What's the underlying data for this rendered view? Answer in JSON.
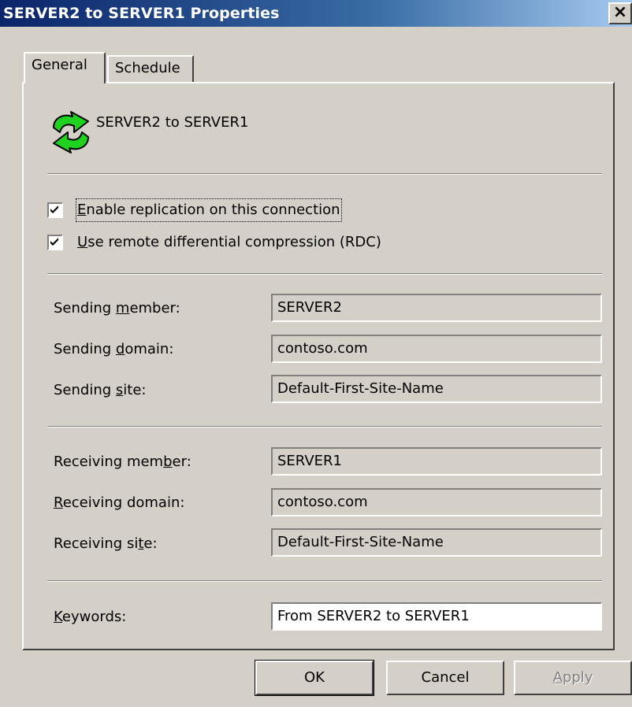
{
  "window": {
    "title": "SERVER2 to SERVER1 Properties",
    "close_glyph": "×"
  },
  "tabs": [
    {
      "label": "General",
      "selected": true
    },
    {
      "label": "Schedule",
      "selected": false
    }
  ],
  "connection": {
    "icon": "replication-arrows-icon",
    "name": "SERVER2 to SERVER1",
    "icon_color": "#1fd21f"
  },
  "options": {
    "enable_replication": {
      "pre": "",
      "mnemonic": "E",
      "post": "nable replication on this connection",
      "checked": true
    },
    "use_rdc": {
      "pre": "",
      "mnemonic": "U",
      "post": "se remote differential compression (RDC)",
      "checked": true
    }
  },
  "sending": {
    "member_label": {
      "pre": "Sending ",
      "mnemonic": "m",
      "post": "ember:"
    },
    "member_value": "SERVER2",
    "domain_label": {
      "pre": "Sending ",
      "mnemonic": "d",
      "post": "omain:"
    },
    "domain_value": "contoso.com",
    "site_label": {
      "pre": "Sending ",
      "mnemonic": "s",
      "post": "ite:"
    },
    "site_value": "Default-First-Site-Name"
  },
  "receiving": {
    "member_label": {
      "pre": "Receiving mem",
      "mnemonic": "b",
      "post": "er:"
    },
    "member_value": "SERVER1",
    "domain_label": {
      "pre": "",
      "mnemonic": "R",
      "post": "eceiving domain:"
    },
    "domain_value": "contoso.com",
    "site_label": {
      "pre": "Receiving si",
      "mnemonic": "t",
      "post": "e:"
    },
    "site_value": "Default-First-Site-Name"
  },
  "keywords": {
    "label": {
      "pre": "",
      "mnemonic": "K",
      "post": "eywords:"
    },
    "value": "From SERVER2 to SERVER1"
  },
  "buttons": {
    "ok": "OK",
    "cancel": "Cancel",
    "apply": {
      "pre": "",
      "mnemonic": "A",
      "post": "pply"
    }
  }
}
